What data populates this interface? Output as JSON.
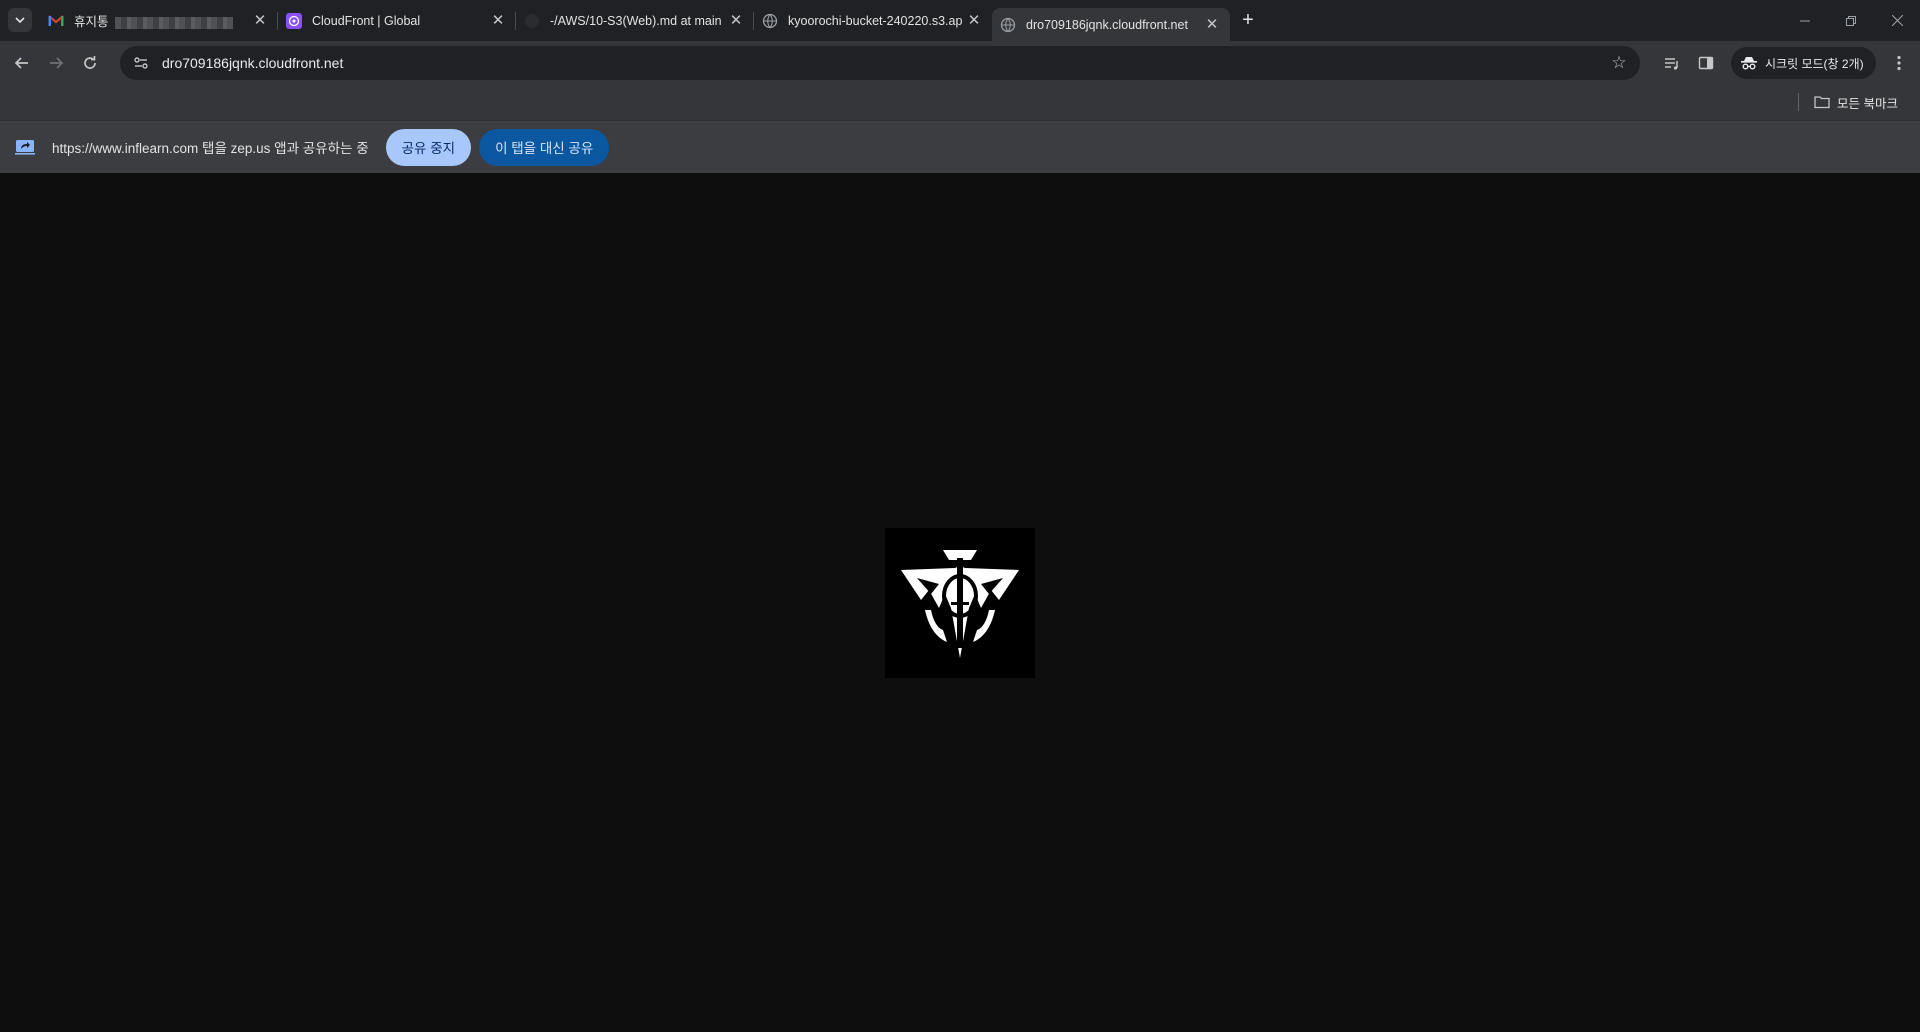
{
  "tabs": [
    {
      "title": "휴지통",
      "icon": "gmail-icon",
      "has_blurred_text": true
    },
    {
      "title": "CloudFront | Global",
      "icon": "aws-cloudfront-icon"
    },
    {
      "title": "-/AWS/10-S3(Web).md at main",
      "icon": "github-icon"
    },
    {
      "title": "kyoorochi-bucket-240220.s3.ap",
      "icon": "globe-icon"
    },
    {
      "title": "dro709186jqnk.cloudfront.net",
      "icon": "globe-icon",
      "active": true
    }
  ],
  "omnibox": {
    "url": "dro709186jqnk.cloudfront.net"
  },
  "toolbar": {
    "incognito_label": "시크릿 모드(창 2개)"
  },
  "bookmarks": {
    "all_bookmarks_label": "모든 북마크"
  },
  "infobar": {
    "message": "https://www.inflearn.com 탭을 zep.us 앱과 공유하는 중",
    "stop_label": "공유 중지",
    "share_this_label": "이 탭을 대신 공유"
  },
  "page": {
    "image_description": "white emblem logo on black square"
  },
  "colors": {
    "tabstrip_bg": "#202124",
    "toolbar_bg": "#35363a",
    "infobar_bg": "#3c3d41",
    "stop_button_bg": "#a8c7fa",
    "share_button_bg": "#0b57a0",
    "page_bg": "#0e0e0e"
  }
}
